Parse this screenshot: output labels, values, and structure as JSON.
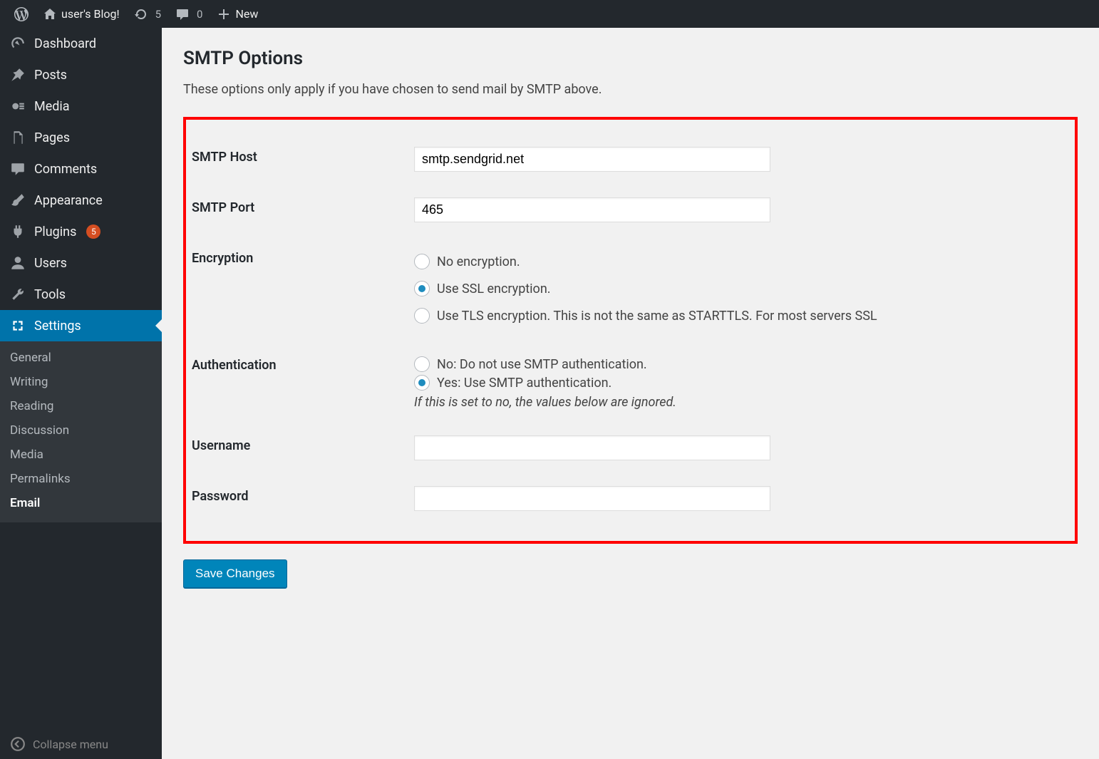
{
  "adminbar": {
    "site_title": "user's Blog!",
    "updates_count": "5",
    "comments_count": "0",
    "new_label": "New"
  },
  "sidebar": {
    "items": [
      {
        "label": "Dashboard"
      },
      {
        "label": "Posts"
      },
      {
        "label": "Media"
      },
      {
        "label": "Pages"
      },
      {
        "label": "Comments"
      },
      {
        "label": "Appearance"
      },
      {
        "label": "Plugins",
        "badge": "5"
      },
      {
        "label": "Users"
      },
      {
        "label": "Tools"
      },
      {
        "label": "Settings"
      }
    ],
    "submenu": [
      {
        "label": "General"
      },
      {
        "label": "Writing"
      },
      {
        "label": "Reading"
      },
      {
        "label": "Discussion"
      },
      {
        "label": "Media"
      },
      {
        "label": "Permalinks"
      },
      {
        "label": "Email"
      }
    ],
    "collapse_label": "Collapse menu"
  },
  "page": {
    "section_title": "SMTP Options",
    "section_desc": "These options only apply if you have chosen to send mail by SMTP above.",
    "fields": {
      "smtp_host": {
        "label": "SMTP Host",
        "value": "smtp.sendgrid.net"
      },
      "smtp_port": {
        "label": "SMTP Port",
        "value": "465"
      },
      "encryption": {
        "label": "Encryption",
        "options": [
          {
            "label": "No encryption.",
            "checked": false
          },
          {
            "label": "Use SSL encryption.",
            "checked": true
          },
          {
            "label": "Use TLS encryption. This is not the same as STARTTLS. For most servers SSL",
            "checked": false
          }
        ]
      },
      "auth": {
        "label": "Authentication",
        "options": [
          {
            "label": "No: Do not use SMTP authentication.",
            "checked": false
          },
          {
            "label": "Yes: Use SMTP authentication.",
            "checked": true
          }
        ],
        "hint": "If this is set to no, the values below are ignored."
      },
      "username": {
        "label": "Username",
        "value": ""
      },
      "password": {
        "label": "Password",
        "value": ""
      }
    },
    "save_label": "Save Changes"
  }
}
